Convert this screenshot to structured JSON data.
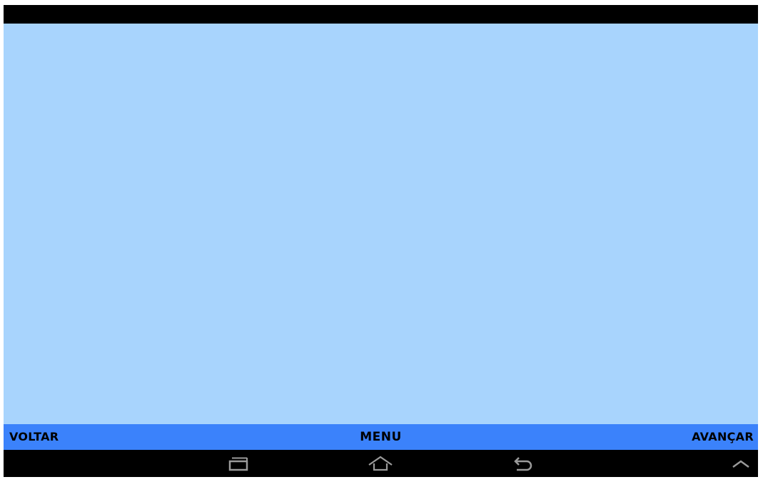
{
  "bottom_nav": {
    "back_label": "VOLTAR",
    "menu_label": "MENU",
    "forward_label": "AVANÇAR"
  },
  "system_bar": {
    "icons": [
      "recent-apps-icon",
      "home-icon",
      "back-icon",
      "chevron-up-icon"
    ]
  },
  "colors": {
    "content_background": "#a8d4fd",
    "nav_bar": "#3b82fb",
    "system_bar": "#000000"
  }
}
